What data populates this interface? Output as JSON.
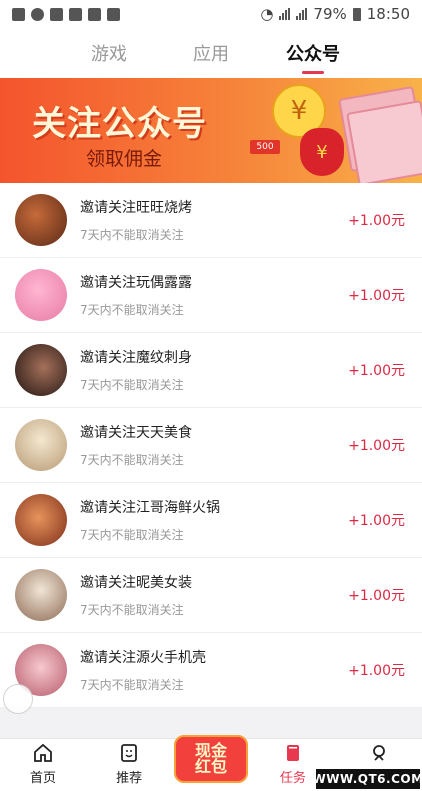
{
  "status_bar": {
    "battery": "79%",
    "time": "18:50"
  },
  "tabs": [
    {
      "label": "游戏",
      "active": false
    },
    {
      "label": "应用",
      "active": false
    },
    {
      "label": "公众号",
      "active": true
    }
  ],
  "banner": {
    "title": "关注公众号",
    "subtitle": "领取佣金",
    "ticket": "500"
  },
  "tasks": [
    {
      "name": "邀请关注旺旺烧烤",
      "desc": "7天内不能取消关注",
      "reward": "+1.00元",
      "avatar_color": "#8b4b2a"
    },
    {
      "name": "邀请关注玩偶露露",
      "desc": "7天内不能取消关注",
      "reward": "+1.00元",
      "avatar_color": "#f59abf"
    },
    {
      "name": "邀请关注魔纹刺身",
      "desc": "7天内不能取消关注",
      "reward": "+1.00元",
      "avatar_color": "#3a2a22"
    },
    {
      "name": "邀请关注天天美食",
      "desc": "7天内不能取消关注",
      "reward": "+1.00元",
      "avatar_color": "#e9d9b8"
    },
    {
      "name": "邀请关注江哥海鲜火锅",
      "desc": "7天内不能取消关注",
      "reward": "+1.00元",
      "avatar_color": "#c8542f"
    },
    {
      "name": "邀请关注昵美女装",
      "desc": "7天内不能取消关注",
      "reward": "+1.00元",
      "avatar_color": "#d8c7b2"
    },
    {
      "name": "邀请关注源火手机壳",
      "desc": "7天内不能取消关注",
      "reward": "+1.00元",
      "avatar_color": "#e6a6ae"
    }
  ],
  "bottom_nav": [
    {
      "label": "首页",
      "icon": "home-icon",
      "active": false
    },
    {
      "label": "推荐",
      "icon": "recommend-icon",
      "active": false
    },
    {
      "label": "任务",
      "icon": "task-icon",
      "active": true
    },
    {
      "label": "我的",
      "icon": "profile-icon",
      "active": false
    }
  ],
  "red_packet": {
    "line1": "现金",
    "line2": "红包"
  },
  "watermark": "WWW.QT6.COM",
  "colors": {
    "accent": "#e8384f",
    "reward": "#d92b44"
  }
}
